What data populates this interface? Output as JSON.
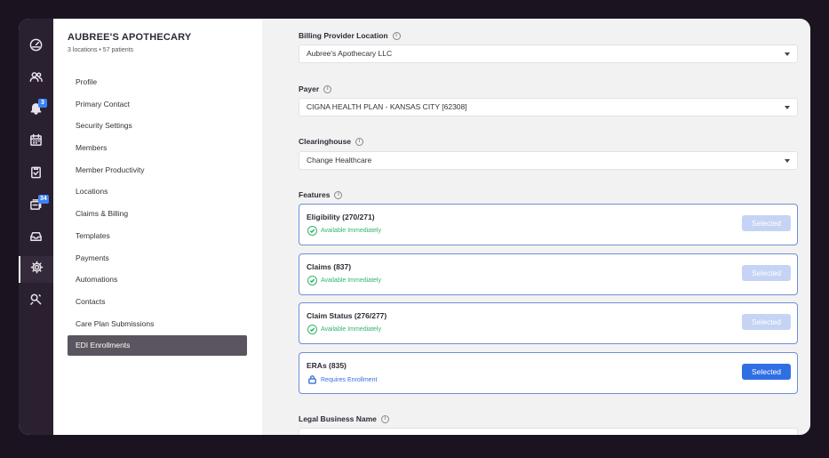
{
  "rail": {
    "items": [
      {
        "icon": "dashboard-icon"
      },
      {
        "icon": "users-icon"
      },
      {
        "icon": "bell-icon",
        "badge": "3"
      },
      {
        "icon": "calendar-icon"
      },
      {
        "icon": "clipboard-check-icon"
      },
      {
        "icon": "inbox-stack-icon",
        "badge": "34"
      },
      {
        "icon": "tray-icon"
      },
      {
        "icon": "gear-icon",
        "active": true
      },
      {
        "icon": "tools-icon"
      }
    ]
  },
  "org": {
    "name": "AUBREE'S APOTHECARY",
    "meta": "3 locations • 57 patients"
  },
  "nav": {
    "items": [
      {
        "label": "Profile"
      },
      {
        "label": "Primary Contact"
      },
      {
        "label": "Security Settings"
      },
      {
        "label": "Members"
      },
      {
        "label": "Member Productivity"
      },
      {
        "label": "Locations"
      },
      {
        "label": "Claims & Billing"
      },
      {
        "label": "Templates"
      },
      {
        "label": "Payments"
      },
      {
        "label": "Automations"
      },
      {
        "label": "Contacts"
      },
      {
        "label": "Care Plan Submissions"
      },
      {
        "label": "EDI Enrollments",
        "active": true
      }
    ]
  },
  "form": {
    "billing_location": {
      "label": "Billing Provider Location",
      "value": "Aubree's Apothecary LLC"
    },
    "payer": {
      "label": "Payer",
      "value": "CIGNA HEALTH PLAN - KANSAS CITY [62308]"
    },
    "clearinghouse": {
      "label": "Clearinghouse",
      "value": "Change Healthcare"
    },
    "features_label": "Features",
    "features": [
      {
        "title": "Eligibility (270/271)",
        "status": "Available Immediately",
        "status_type": "ok",
        "button": "Selected",
        "button_state": "disabled"
      },
      {
        "title": "Claims (837)",
        "status": "Available Immediately",
        "status_type": "ok",
        "button": "Selected",
        "button_state": "disabled"
      },
      {
        "title": "Claim Status (276/277)",
        "status": "Available Immediately",
        "status_type": "ok",
        "button": "Selected",
        "button_state": "disabled"
      },
      {
        "title": "ERAs (835)",
        "status": "Requires Enrollment",
        "status_type": "enroll",
        "button": "Selected",
        "button_state": "active"
      }
    ],
    "legal_business_name": {
      "label": "Legal Business Name"
    }
  },
  "colors": {
    "rail_bg": "#2a2030",
    "accent": "#2f6fe4",
    "success": "#31b56a",
    "active_nav": "#5b5560"
  }
}
